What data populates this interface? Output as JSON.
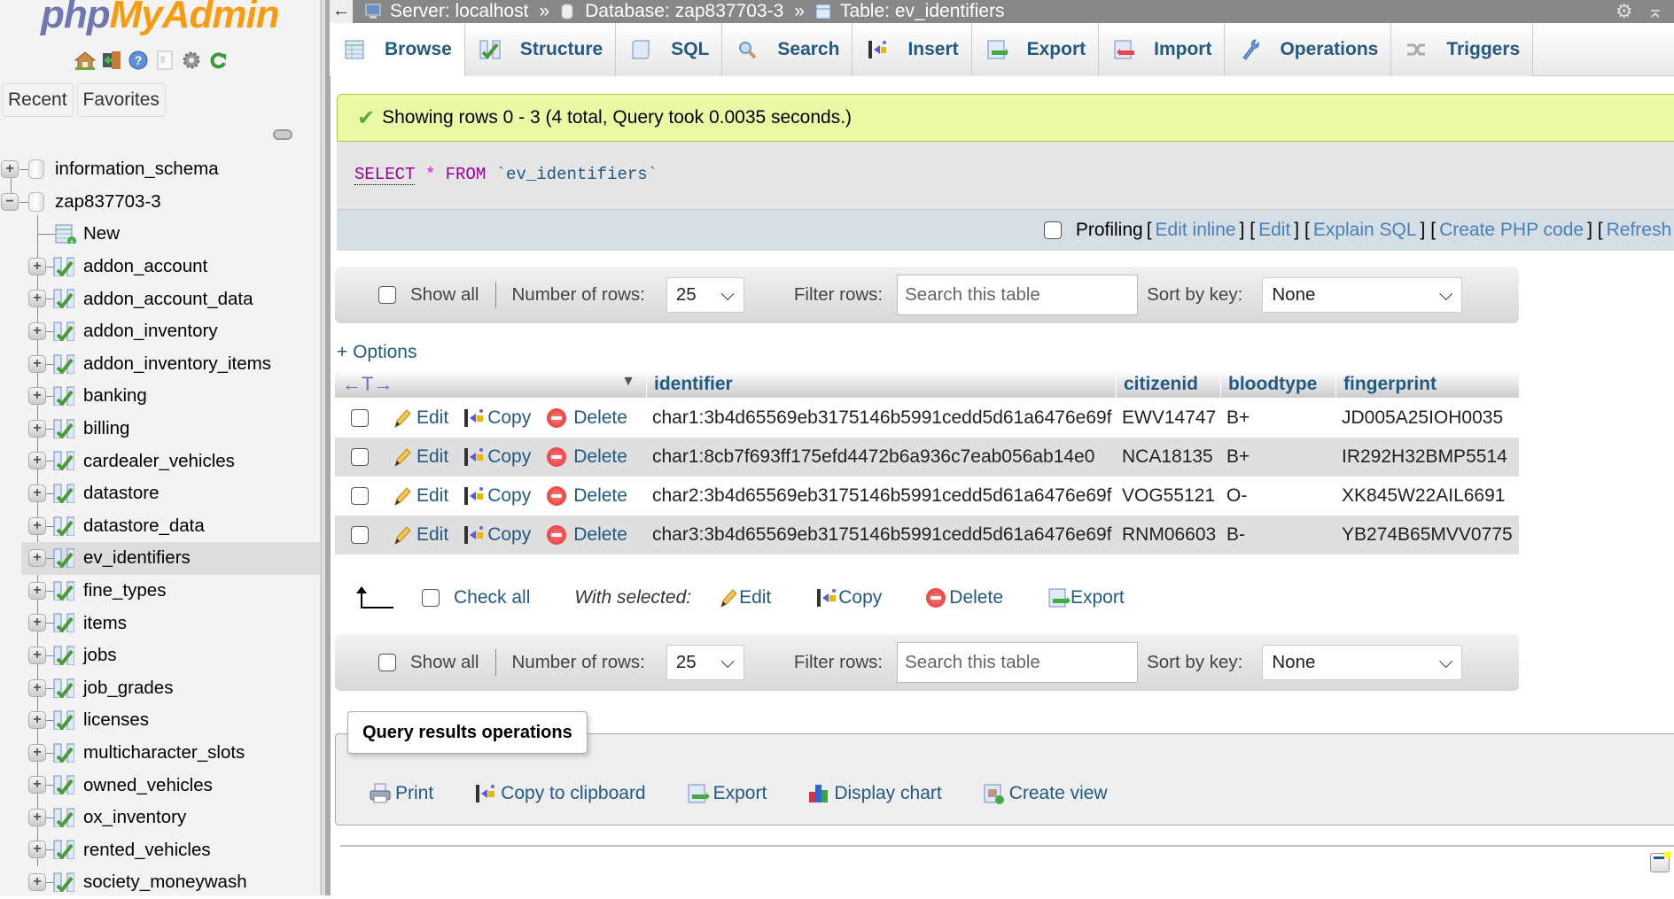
{
  "sidebar": {
    "logo_php": "php",
    "logo_myadmin": "MyAdmin",
    "nav_icons": [
      "home-icon",
      "logout-icon",
      "help-icon",
      "docs-icon",
      "settings-icon",
      "reload-icon"
    ],
    "tabs": [
      "Recent",
      "Favorites"
    ],
    "databases": [
      {
        "name": "information_schema",
        "expanded": false
      },
      {
        "name": "zap837703-3",
        "expanded": true
      }
    ],
    "new_label": "New",
    "tables": [
      "addon_account",
      "addon_account_data",
      "addon_inventory",
      "addon_inventory_items",
      "banking",
      "billing",
      "cardealer_vehicles",
      "datastore",
      "datastore_data",
      "ev_identifiers",
      "fine_types",
      "items",
      "jobs",
      "job_grades",
      "licenses",
      "multicharacter_slots",
      "owned_vehicles",
      "ox_inventory",
      "rented_vehicles",
      "society_moneywash"
    ],
    "selected_table": "ev_identifiers"
  },
  "breadcrumb": {
    "back": "←",
    "server": "Server: localhost",
    "database": "Database: zap837703-3",
    "table": "Table: ev_identifiers",
    "separator": "»"
  },
  "tabs": [
    {
      "label": "Browse",
      "icon": "browse-icon",
      "active": true
    },
    {
      "label": "Structure",
      "icon": "structure-icon"
    },
    {
      "label": "SQL",
      "icon": "sql-icon"
    },
    {
      "label": "Search",
      "icon": "search-icon"
    },
    {
      "label": "Insert",
      "icon": "insert-icon"
    },
    {
      "label": "Export",
      "icon": "export-icon"
    },
    {
      "label": "Import",
      "icon": "import-icon"
    },
    {
      "label": "Operations",
      "icon": "operations-icon"
    },
    {
      "label": "Triggers",
      "icon": "triggers-icon"
    }
  ],
  "success_message": "Showing rows 0 - 3 (4 total, Query took 0.0035 seconds.)",
  "sql": {
    "select": "SELECT",
    "star": "*",
    "from": "FROM",
    "table": "`ev_identifiers`"
  },
  "profiling": {
    "label": "Profiling",
    "links": [
      "Edit inline",
      "Edit",
      "Explain SQL",
      "Create PHP code",
      "Refresh"
    ]
  },
  "navbar": {
    "show_all": "Show all",
    "num_rows_label": "Number of rows:",
    "num_rows_value": "25",
    "filter_label": "Filter rows:",
    "filter_placeholder": "Search this table",
    "sort_label": "Sort by key:",
    "sort_value": "None"
  },
  "options_link": "+ Options",
  "table": {
    "sort_arrows": "←T→",
    "columns": [
      "identifier",
      "citizenid",
      "bloodtype",
      "fingerprint"
    ],
    "row_actions": {
      "edit": "Edit",
      "copy": "Copy",
      "delete": "Delete"
    },
    "rows": [
      [
        "char1:3b4d65569eb3175146b5991cedd5d61a6476e69f",
        "EWV14747",
        "B+",
        "JD005A25IOH0035"
      ],
      [
        "char1:8cb7f693ff175efd4472b6a936c7eab056ab14e0",
        "NCA18135",
        "B+",
        "IR292H32BMP5514"
      ],
      [
        "char2:3b4d65569eb3175146b5991cedd5d61a6476e69f",
        "VOG55121",
        "O-",
        "XK845W22AIL6691"
      ],
      [
        "char3:3b4d65569eb3175146b5991cedd5d61a6476e69f",
        "RNM06603",
        "B-",
        "YB274B65MVV0775"
      ]
    ]
  },
  "bulk": {
    "check_all": "Check all",
    "with_selected": "With selected:",
    "actions": [
      "Edit",
      "Copy",
      "Delete",
      "Export"
    ]
  },
  "query_results_ops": {
    "legend": "Query results operations",
    "links": [
      "Print",
      "Copy to clipboard",
      "Export",
      "Display chart",
      "Create view"
    ]
  }
}
